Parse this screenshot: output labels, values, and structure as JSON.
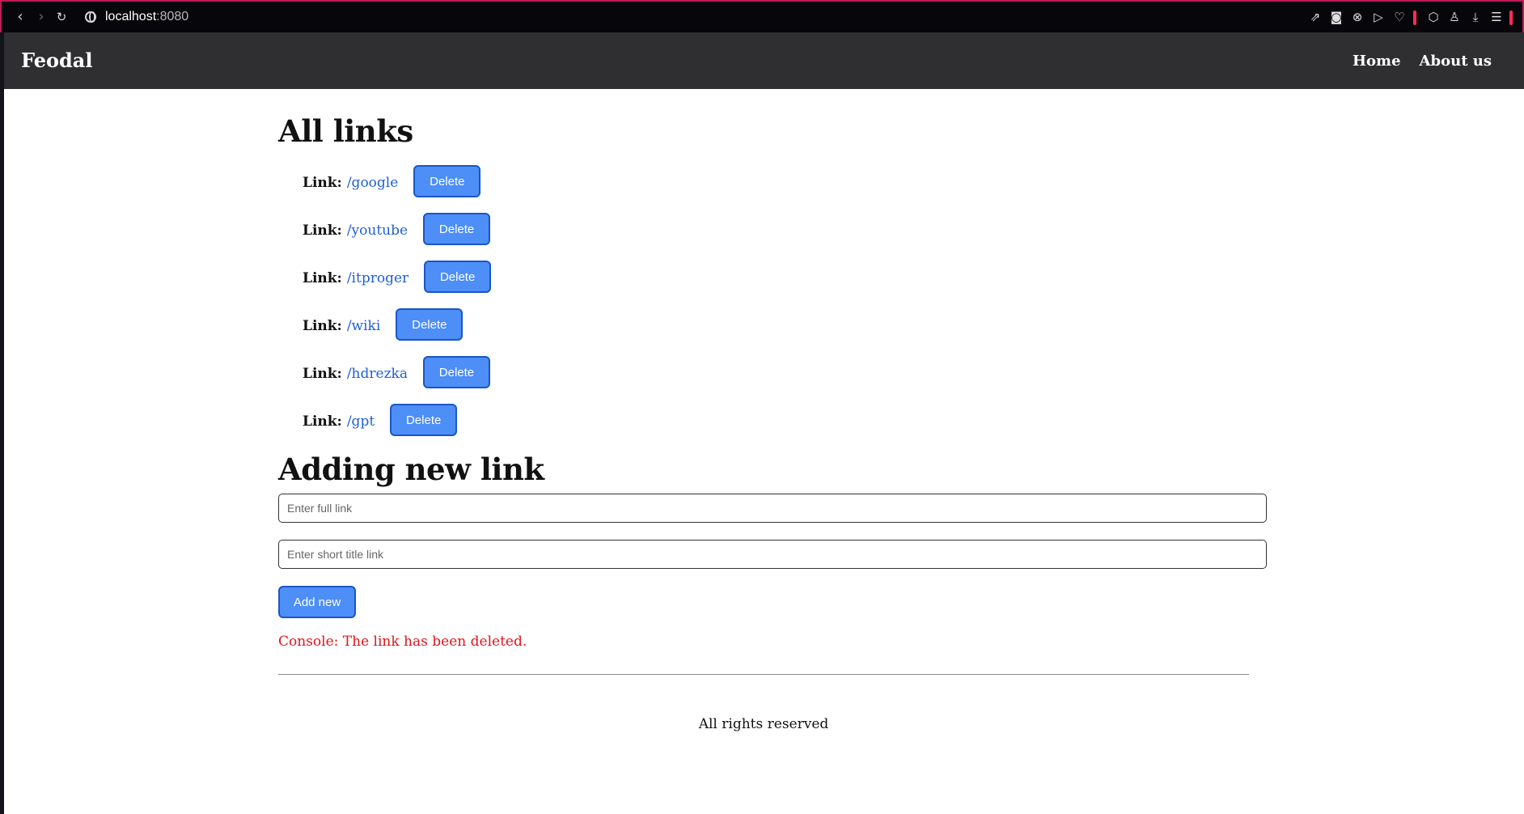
{
  "browser": {
    "url_host": "localhost",
    "url_port": ":8080",
    "toolbar_icons": [
      "back-icon",
      "forward-icon",
      "reload-icon",
      "globe-icon",
      "chart-icon",
      "camera-icon",
      "shield-x-icon",
      "send-icon",
      "heart-icon",
      "box-icon",
      "user-icon",
      "download-icon",
      "menu-icon"
    ]
  },
  "header": {
    "brand": "Feodal",
    "nav": [
      {
        "label": "Home"
      },
      {
        "label": "About us"
      }
    ]
  },
  "links_section": {
    "title": "All links",
    "label_prefix": "Link:",
    "delete_label": "Delete",
    "items": [
      {
        "path": "/google"
      },
      {
        "path": "/youtube"
      },
      {
        "path": "/itproger"
      },
      {
        "path": "/wiki"
      },
      {
        "path": "/hdrezka"
      },
      {
        "path": "/gpt"
      }
    ]
  },
  "add_section": {
    "title": "Adding new link",
    "full_link_placeholder": "Enter full link",
    "short_title_placeholder": "Enter short title link",
    "add_button_label": "Add new"
  },
  "console": {
    "message": "Console: The link has been deleted.",
    "color": "#e0141c"
  },
  "footer": {
    "text": "All rights reserved"
  },
  "colors": {
    "header_bg": "#2f2f31",
    "button_bg": "#4d8ef7",
    "button_border": "#1a56c7",
    "link_color": "#1f5fd6"
  }
}
